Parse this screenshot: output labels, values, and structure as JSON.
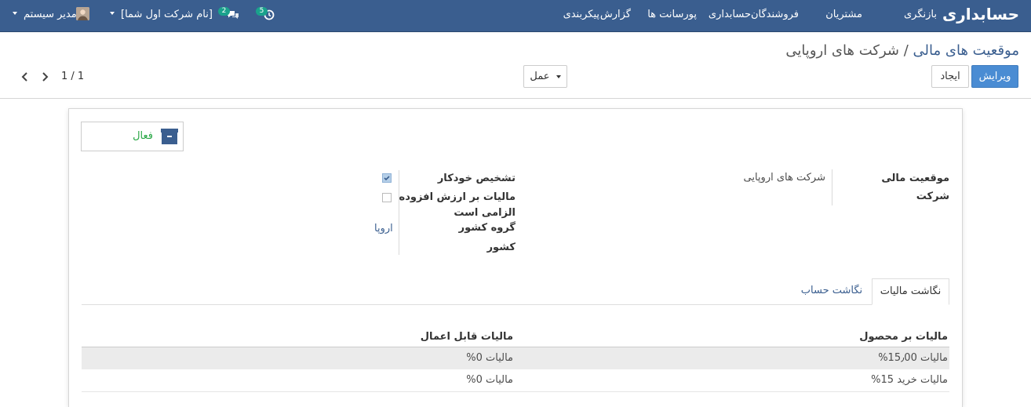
{
  "navbar": {
    "brand": "حسابداری",
    "menu": [
      "بازنگری",
      "مشتریان",
      "فروشندگان",
      "حسابداری",
      "پورسانت ها",
      "گزارش",
      "پیکربندی"
    ],
    "activity_count": "5",
    "messages_count": "2",
    "company": "[نام شرکت اول شما]",
    "user": "مدیر سیستم"
  },
  "breadcrumb": {
    "parent": "موقعیت های مالی",
    "separator": "/",
    "current": "شرکت های اروپایی"
  },
  "buttons": {
    "edit": "ویرایش",
    "create": "ایجاد",
    "action": "عمل"
  },
  "pager": {
    "value": "1 / 1"
  },
  "status_button": {
    "label": "فعال"
  },
  "fields": {
    "fiscal_position_label": "موقعیت مالی",
    "fiscal_position_value": "شرکت های اروپایی",
    "company_label": "شرکت",
    "auto_detect_label": "تشخیص خودکار",
    "auto_detect_checked": true,
    "vat_required_label_1": "مالیات بر ارزش افزوده",
    "vat_required_label_2": "الزامی است",
    "vat_required_checked": false,
    "country_group_label": "گروه کشور",
    "country_group_value": "اروپا",
    "country_label": "کشور"
  },
  "tabs": {
    "tax_mapping": "نگاشت مالیات",
    "account_mapping": "نگاشت حساب",
    "active": "tax_mapping"
  },
  "table": {
    "headers": {
      "product_tax": "مالیات بر محصول",
      "applied_tax": "مالیات قابل اعمال"
    },
    "rows": [
      {
        "product_tax": "مالیات 15٫00%",
        "applied_tax": "مالیات 0%"
      },
      {
        "product_tax": "مالیات خرید 15%",
        "applied_tax": "مالیات 0%"
      }
    ]
  },
  "colors": {
    "navbar": "#3a5e8f",
    "primary": "#4a8cd3",
    "badge": "#1aa28c",
    "link": "#3a5e8f",
    "active_status": "#28a745"
  }
}
